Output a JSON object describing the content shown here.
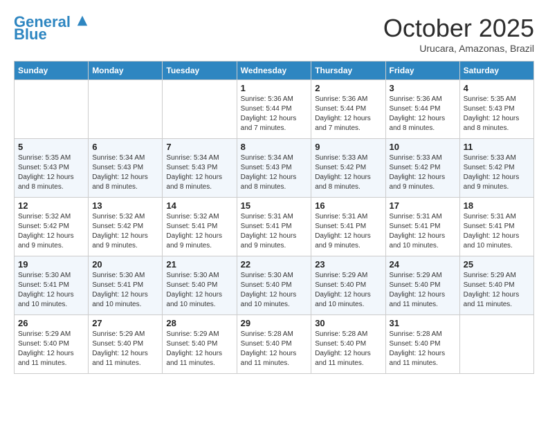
{
  "header": {
    "logo_line1": "General",
    "logo_line2": "Blue",
    "month": "October 2025",
    "location": "Urucara, Amazonas, Brazil"
  },
  "days_of_week": [
    "Sunday",
    "Monday",
    "Tuesday",
    "Wednesday",
    "Thursday",
    "Friday",
    "Saturday"
  ],
  "weeks": [
    [
      {
        "num": "",
        "info": ""
      },
      {
        "num": "",
        "info": ""
      },
      {
        "num": "",
        "info": ""
      },
      {
        "num": "1",
        "info": "Sunrise: 5:36 AM\nSunset: 5:44 PM\nDaylight: 12 hours\nand 7 minutes."
      },
      {
        "num": "2",
        "info": "Sunrise: 5:36 AM\nSunset: 5:44 PM\nDaylight: 12 hours\nand 7 minutes."
      },
      {
        "num": "3",
        "info": "Sunrise: 5:36 AM\nSunset: 5:44 PM\nDaylight: 12 hours\nand 8 minutes."
      },
      {
        "num": "4",
        "info": "Sunrise: 5:35 AM\nSunset: 5:43 PM\nDaylight: 12 hours\nand 8 minutes."
      }
    ],
    [
      {
        "num": "5",
        "info": "Sunrise: 5:35 AM\nSunset: 5:43 PM\nDaylight: 12 hours\nand 8 minutes."
      },
      {
        "num": "6",
        "info": "Sunrise: 5:34 AM\nSunset: 5:43 PM\nDaylight: 12 hours\nand 8 minutes."
      },
      {
        "num": "7",
        "info": "Sunrise: 5:34 AM\nSunset: 5:43 PM\nDaylight: 12 hours\nand 8 minutes."
      },
      {
        "num": "8",
        "info": "Sunrise: 5:34 AM\nSunset: 5:43 PM\nDaylight: 12 hours\nand 8 minutes."
      },
      {
        "num": "9",
        "info": "Sunrise: 5:33 AM\nSunset: 5:42 PM\nDaylight: 12 hours\nand 8 minutes."
      },
      {
        "num": "10",
        "info": "Sunrise: 5:33 AM\nSunset: 5:42 PM\nDaylight: 12 hours\nand 9 minutes."
      },
      {
        "num": "11",
        "info": "Sunrise: 5:33 AM\nSunset: 5:42 PM\nDaylight: 12 hours\nand 9 minutes."
      }
    ],
    [
      {
        "num": "12",
        "info": "Sunrise: 5:32 AM\nSunset: 5:42 PM\nDaylight: 12 hours\nand 9 minutes."
      },
      {
        "num": "13",
        "info": "Sunrise: 5:32 AM\nSunset: 5:42 PM\nDaylight: 12 hours\nand 9 minutes."
      },
      {
        "num": "14",
        "info": "Sunrise: 5:32 AM\nSunset: 5:41 PM\nDaylight: 12 hours\nand 9 minutes."
      },
      {
        "num": "15",
        "info": "Sunrise: 5:31 AM\nSunset: 5:41 PM\nDaylight: 12 hours\nand 9 minutes."
      },
      {
        "num": "16",
        "info": "Sunrise: 5:31 AM\nSunset: 5:41 PM\nDaylight: 12 hours\nand 9 minutes."
      },
      {
        "num": "17",
        "info": "Sunrise: 5:31 AM\nSunset: 5:41 PM\nDaylight: 12 hours\nand 10 minutes."
      },
      {
        "num": "18",
        "info": "Sunrise: 5:31 AM\nSunset: 5:41 PM\nDaylight: 12 hours\nand 10 minutes."
      }
    ],
    [
      {
        "num": "19",
        "info": "Sunrise: 5:30 AM\nSunset: 5:41 PM\nDaylight: 12 hours\nand 10 minutes."
      },
      {
        "num": "20",
        "info": "Sunrise: 5:30 AM\nSunset: 5:41 PM\nDaylight: 12 hours\nand 10 minutes."
      },
      {
        "num": "21",
        "info": "Sunrise: 5:30 AM\nSunset: 5:40 PM\nDaylight: 12 hours\nand 10 minutes."
      },
      {
        "num": "22",
        "info": "Sunrise: 5:30 AM\nSunset: 5:40 PM\nDaylight: 12 hours\nand 10 minutes."
      },
      {
        "num": "23",
        "info": "Sunrise: 5:29 AM\nSunset: 5:40 PM\nDaylight: 12 hours\nand 10 minutes."
      },
      {
        "num": "24",
        "info": "Sunrise: 5:29 AM\nSunset: 5:40 PM\nDaylight: 12 hours\nand 11 minutes."
      },
      {
        "num": "25",
        "info": "Sunrise: 5:29 AM\nSunset: 5:40 PM\nDaylight: 12 hours\nand 11 minutes."
      }
    ],
    [
      {
        "num": "26",
        "info": "Sunrise: 5:29 AM\nSunset: 5:40 PM\nDaylight: 12 hours\nand 11 minutes."
      },
      {
        "num": "27",
        "info": "Sunrise: 5:29 AM\nSunset: 5:40 PM\nDaylight: 12 hours\nand 11 minutes."
      },
      {
        "num": "28",
        "info": "Sunrise: 5:29 AM\nSunset: 5:40 PM\nDaylight: 12 hours\nand 11 minutes."
      },
      {
        "num": "29",
        "info": "Sunrise: 5:28 AM\nSunset: 5:40 PM\nDaylight: 12 hours\nand 11 minutes."
      },
      {
        "num": "30",
        "info": "Sunrise: 5:28 AM\nSunset: 5:40 PM\nDaylight: 12 hours\nand 11 minutes."
      },
      {
        "num": "31",
        "info": "Sunrise: 5:28 AM\nSunset: 5:40 PM\nDaylight: 12 hours\nand 11 minutes."
      },
      {
        "num": "",
        "info": ""
      }
    ]
  ]
}
